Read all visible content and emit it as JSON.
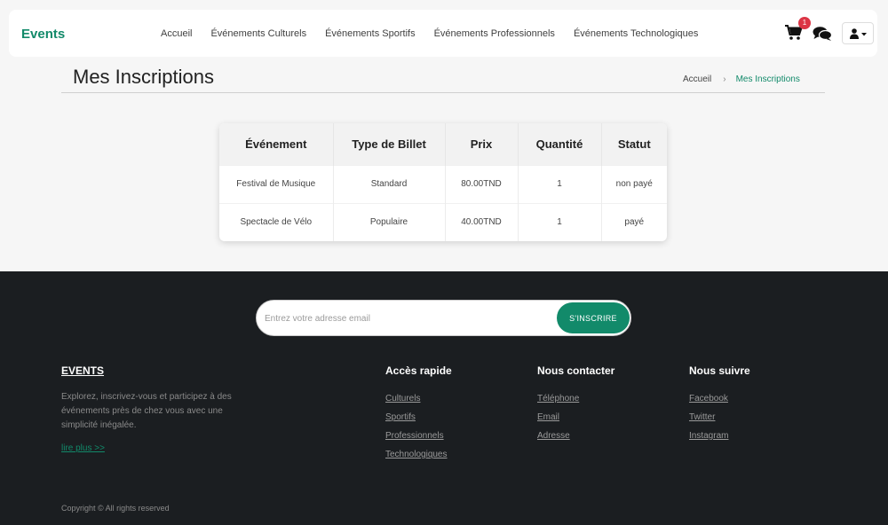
{
  "navbar": {
    "brand": "Events",
    "links": [
      "Accueil",
      "Événements Culturels",
      "Événements Sportifs",
      "Événements Professionnels",
      "Événements Technologiques"
    ],
    "cart_count": "1"
  },
  "header": {
    "title": "Mes Inscriptions",
    "breadcrumb": {
      "home": "Accueil",
      "separator": "›",
      "current": "Mes Inscriptions"
    }
  },
  "table": {
    "columns": [
      "Événement",
      "Type de Billet",
      "Prix",
      "Quantité",
      "Statut"
    ],
    "rows": [
      [
        "Festival de Musique",
        "Standard",
        "80.00TND",
        "1",
        "non payé"
      ],
      [
        "Spectacle de Vélo",
        "Populaire",
        "40.00TND",
        "1",
        "payé"
      ]
    ]
  },
  "footer": {
    "newsletter_placeholder": "Entrez votre adresse email",
    "subscribe_label": "S'INSCRIRE",
    "brand": "EVENTS",
    "description": "Explorez, inscrivez-vous et participez à des événements près de chez vous avec une simplicité inégalée.",
    "read_more": "lire plus >>",
    "columns": [
      {
        "title": "Accès rapide",
        "links": [
          "Culturels",
          "Sportifs",
          "Professionnels",
          "Technologiques"
        ]
      },
      {
        "title": "Nous contacter",
        "links": [
          "Téléphone",
          "Email",
          "Adresse"
        ]
      },
      {
        "title": "Nous suivre",
        "links": [
          "Facebook",
          "Twitter",
          "Instagram"
        ]
      }
    ],
    "copyright": "Copyright © All rights reserved"
  },
  "colors": {
    "accent": "#128a6a",
    "badge": "#dc3545",
    "footer_bg": "#1b1e21"
  },
  "icons": [
    "cart-icon",
    "chat-icon",
    "user-icon",
    "caret-down-icon"
  ]
}
